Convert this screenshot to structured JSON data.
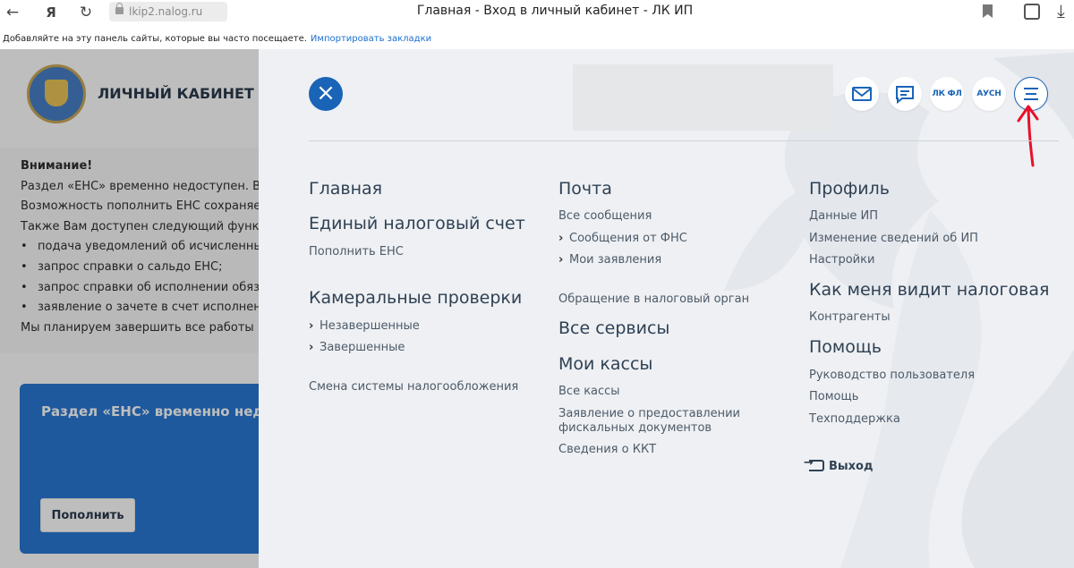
{
  "browser": {
    "url": "lkip2.nalog.ru",
    "window_title": "Главная - Вход в личный кабинет - ЛК ИП",
    "bookmarks_prompt": "Добавляйте на эту панель сайты, которые вы часто посещаете.",
    "import_bookmarks": "Импортировать закладки",
    "back_icon": "←",
    "yandex_icon": "Я",
    "reload_icon": "↻"
  },
  "background_page": {
    "site_title": "ЛИЧНЫЙ КАБИНЕТ ИП",
    "notice": {
      "heading": "Внимание!",
      "lines": [
        "Раздел «ЕНС» временно недоступен. В на",
        "Возможность пополнить ЕНС сохраняет",
        "Также Вам доступен следующий функцис"
      ],
      "bullets": [
        "подача уведомлений об исчисленных",
        "запрос справки о сальдо ЕНС;",
        "запрос справки об исполнении обязан",
        "заявление о зачете в счет исполнения"
      ],
      "last_line": "Мы планируем завершить все работы в "
    },
    "card_title": "Раздел «ЕНС» временно недосту",
    "card_button": "Пополнить"
  },
  "menu_panel": {
    "header_buttons": {
      "lk_fl": "ЛК ФЛ",
      "ausn": "АУСН"
    },
    "col1": {
      "main": "Главная",
      "ens_heading": "Единый налоговый счет",
      "ens_topup": "Пополнить ЕНС",
      "audits_heading": "Камеральные проверки",
      "audits_open": "Незавершенные",
      "audits_done": "Завершенные",
      "tax_regime": "Смена системы налогообложения"
    },
    "col2": {
      "mail_heading": "Почта",
      "all_messages": "Все сообщения",
      "fns_messages": "Сообщения от ФНС",
      "my_requests": "Мои заявления",
      "appeal": "Обращение в налоговый орган",
      "all_services": "Все сервисы",
      "kassy_heading": "Мои кассы",
      "all_kassy": "Все кассы",
      "fiscal_line1": "Заявление о предоставлении",
      "fiscal_line2": "фискальных документов",
      "kkt_info": "Сведения о ККТ"
    },
    "col3": {
      "profile_heading": "Профиль",
      "ip_data": "Данные ИП",
      "change_info": "Изменение сведений об ИП",
      "settings": "Настройки",
      "tax_view_heading": "Как меня видит налоговая",
      "counterparties": "Контрагенты",
      "help_heading": "Помощь",
      "user_guide": "Руководство пользователя",
      "help": "Помощь",
      "support": "Техподдержка",
      "logout": "Выход"
    }
  },
  "colors": {
    "brand_blue": "#1a64b8",
    "panel_bg": "#eef0f3",
    "annotation_red": "#e8102a"
  }
}
